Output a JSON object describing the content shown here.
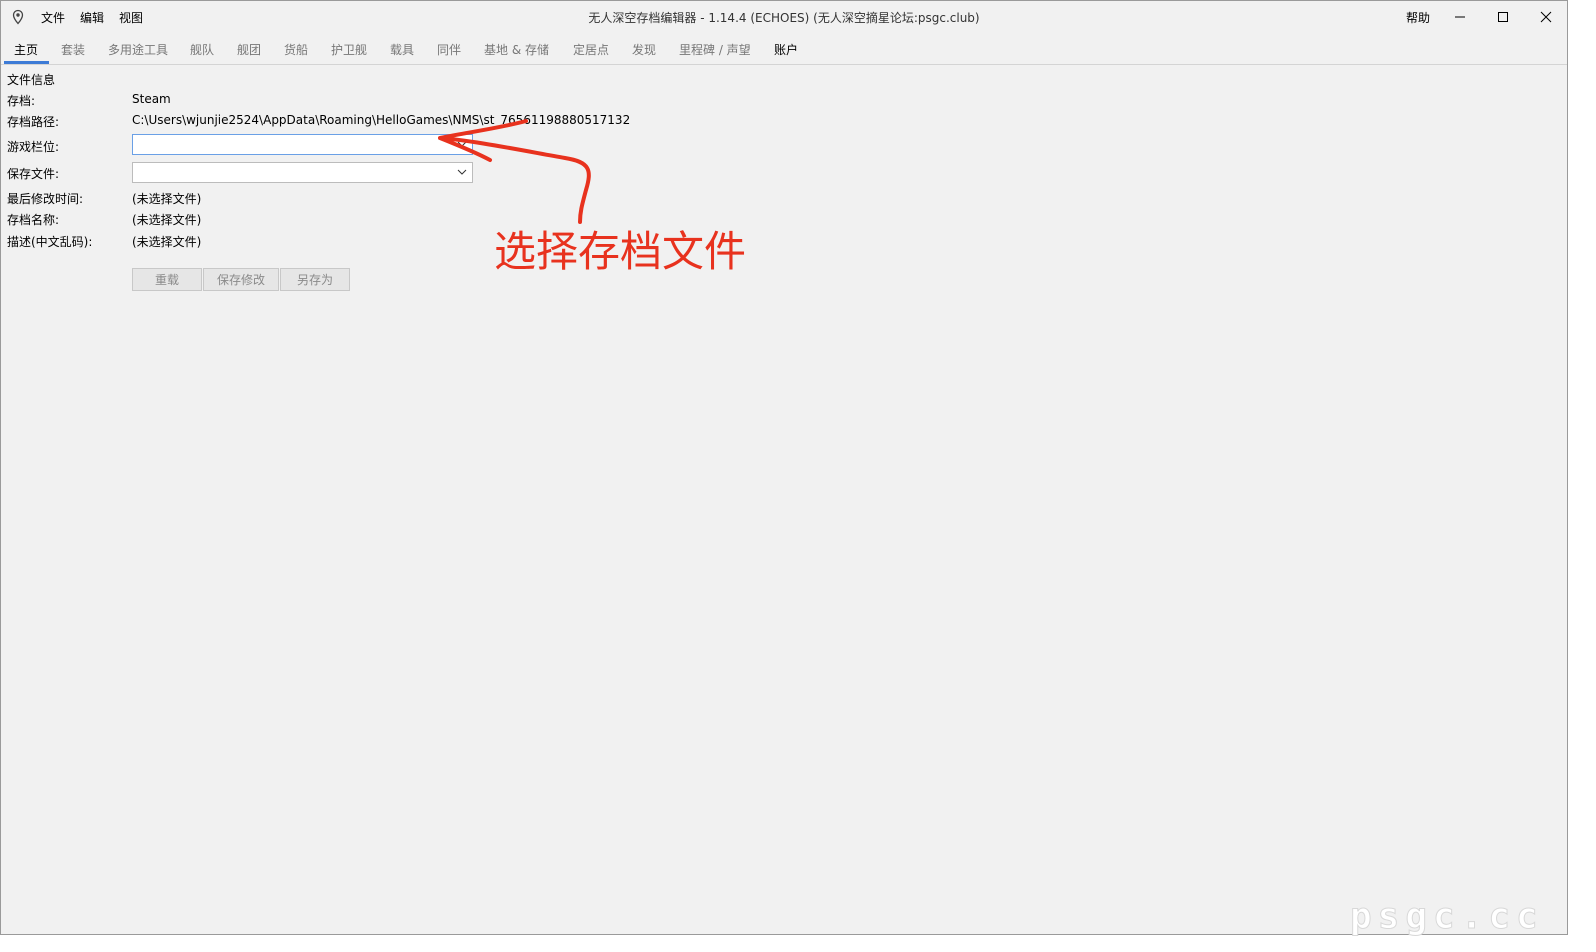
{
  "titlebar": {
    "menu": [
      "文件",
      "编辑",
      "视图"
    ],
    "title": "无人深空存档编辑器 - 1.14.4 (ECHOES) (无人深空摘星论坛:psgc.club)",
    "help": "帮助"
  },
  "tabs": [
    "主页",
    "套装",
    "多用途工具",
    "舰队",
    "舰团",
    "货船",
    "护卫舰",
    "载具",
    "同伴",
    "基地 & 存储",
    "定居点",
    "发现",
    "里程碑 / 声望",
    "账户"
  ],
  "file_info": {
    "section_title": "文件信息",
    "save_label": "存档:",
    "save_value": "Steam",
    "path_label": "存档路径:",
    "path_value": "C:\\Users\\wjunjie2524\\AppData\\Roaming\\HelloGames\\NMS\\st_76561198880517132",
    "slot_label": "游戏栏位:",
    "slot_value": "",
    "savefile_label": "保存文件:",
    "savefile_value": "",
    "modified_label": "最后修改时间:",
    "modified_value": "(未选择文件)",
    "name_label": "存档名称:",
    "name_value": "(未选择文件)",
    "desc_label": "描述(中文乱码):",
    "desc_value": "(未选择文件)"
  },
  "buttons": {
    "reload": "重载",
    "save": "保存修改",
    "save_as": "另存为"
  },
  "annotation": {
    "text": "选择存档文件",
    "color": "#e8321e"
  },
  "watermark": "psgc.cc",
  "colors": {
    "accent": "#3d7bd6",
    "background": "#f1f1f1"
  }
}
